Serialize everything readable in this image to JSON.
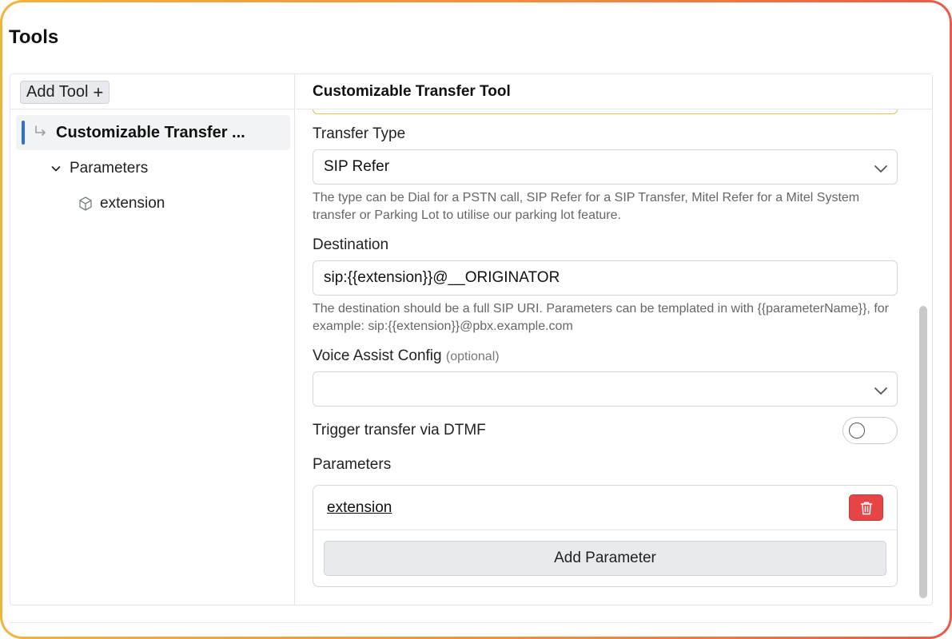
{
  "page": {
    "title": "Tools"
  },
  "sidebar": {
    "add_tool_label": "Add Tool",
    "tree": {
      "tool_label": "Customizable Transfer ...",
      "parameters_label": "Parameters",
      "parameter_item": "extension"
    }
  },
  "editor": {
    "title": "Customizable Transfer Tool",
    "transfer_type": {
      "label": "Transfer Type",
      "value": "SIP Refer",
      "help": "The type can be Dial for a PSTN call, SIP Refer for a SIP Transfer, Mitel Refer for a Mitel System transfer or Parking Lot to utilise our parking lot feature."
    },
    "destination": {
      "label": "Destination",
      "value": "sip:{{extension}}@__ORIGINATOR",
      "help": "The destination should be a full SIP URI. Parameters can be templated in with {{parameterName}}, for example: sip:{{extension}}@pbx.example.com"
    },
    "voice_assist": {
      "label": "Voice Assist Config",
      "optional": "(optional)",
      "value": ""
    },
    "dtmf": {
      "label": "Trigger transfer via DTMF",
      "enabled": false
    },
    "parameters": {
      "label": "Parameters",
      "items": [
        "extension"
      ],
      "add_label": "Add Parameter"
    }
  },
  "colors": {
    "accent": "#2f6fd8",
    "danger": "#e64545",
    "frame_gradient": [
      "#f0b43c",
      "#f08a3c",
      "#ea5a4a"
    ]
  }
}
